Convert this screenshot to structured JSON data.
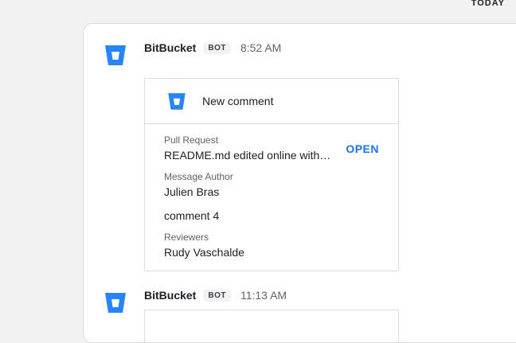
{
  "date_divider": "TODAY",
  "colors": {
    "bitbucket_blue": "#2684ff",
    "link_blue": "#1a73e8"
  },
  "messages": [
    {
      "sender": "BitBucket",
      "badge": "BOT",
      "time": "8:52 AM",
      "avatar_icon": "bitbucket-logo-icon",
      "card": {
        "title": "New comment",
        "fields": [
          {
            "label": "Pull Request",
            "value": "README.md edited online with…"
          },
          {
            "label": "Message Author",
            "value": "Julien Bras"
          },
          {
            "label": "",
            "value": "comment 4"
          },
          {
            "label": "Reviewers",
            "value": "Rudy Vaschalde"
          }
        ],
        "action": "OPEN"
      }
    },
    {
      "sender": "BitBucket",
      "badge": "BOT",
      "time": "11:13 AM",
      "avatar_icon": "bitbucket-logo-icon"
    }
  ]
}
